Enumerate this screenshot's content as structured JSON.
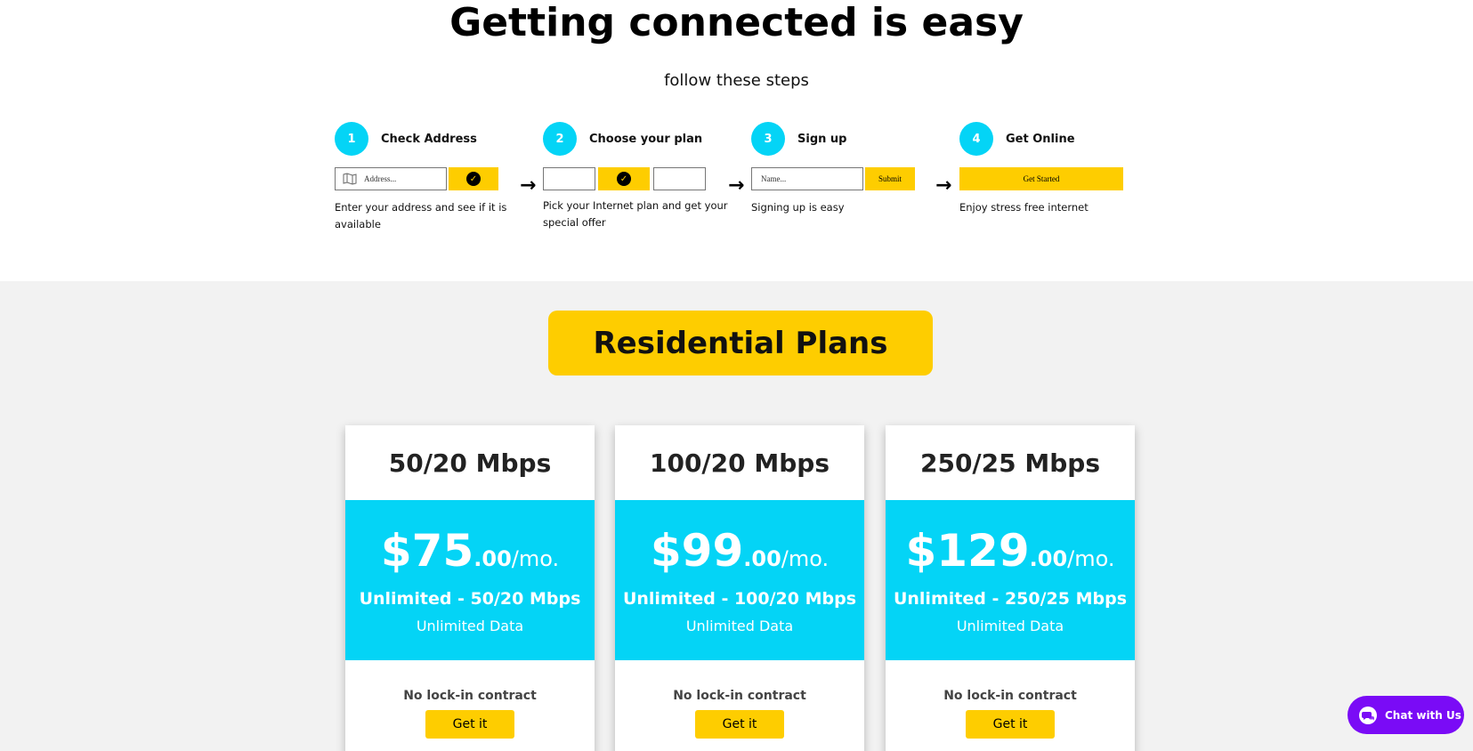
{
  "hero": {
    "title": "Getting connected is easy",
    "subtitle": "follow these steps"
  },
  "steps": [
    {
      "number": "1",
      "title": "Check Address",
      "placeholder": "Address...",
      "description": "Enter your address and see if it is available"
    },
    {
      "number": "2",
      "title": "Choose your plan",
      "description": "Pick your Internet plan and get your special offer"
    },
    {
      "number": "3",
      "title": "Sign up",
      "placeholder": "Name...",
      "button": "Submit",
      "description": "Signing up is easy"
    },
    {
      "number": "4",
      "title": "Get Online",
      "button": "Get Started",
      "description": "Enjoy stress free internet"
    }
  ],
  "plans_section": {
    "title": "Residential Plans",
    "cards": [
      {
        "speed": "50/20 Mbps",
        "price_main": "$75",
        "price_cents": ".00",
        "price_period": "/mo.",
        "plan": "Unlimited - 50/20 Mbps",
        "data": "Unlimited Data",
        "contract": "No lock-in contract",
        "button": "Get it"
      },
      {
        "speed": "100/20 Mbps",
        "price_main": "$99",
        "price_cents": ".00",
        "price_period": "/mo.",
        "plan": "Unlimited - 100/20 Mbps",
        "data": "Unlimited Data",
        "contract": "No lock-in contract",
        "button": "Get it"
      },
      {
        "speed": "250/25 Mbps",
        "price_main": "$129",
        "price_cents": ".00",
        "price_period": "/mo.",
        "plan": "Unlimited - 250/25 Mbps",
        "data": "Unlimited Data",
        "contract": "No lock-in contract",
        "button": "Get it"
      }
    ]
  },
  "chat": {
    "label": "Chat with Us",
    "icon": "chat-bubbles-icon"
  },
  "colors": {
    "accent_yellow": "#fecd00",
    "accent_cyan": "#04d4f6",
    "chat_purple": "#7a0bf6",
    "section_bg": "#f2f2f2"
  }
}
